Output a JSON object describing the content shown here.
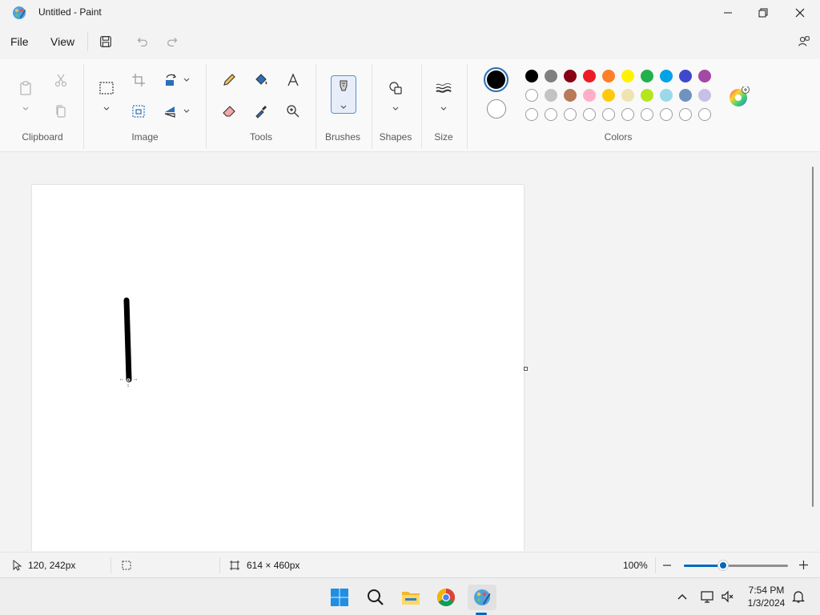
{
  "window": {
    "title": "Untitled - Paint"
  },
  "menu": {
    "file": "File",
    "view": "View"
  },
  "ribbon": {
    "groups": {
      "clipboard": "Clipboard",
      "image": "Image",
      "tools": "Tools",
      "brushes": "Brushes",
      "shapes": "Shapes",
      "size": "Size",
      "colors": "Colors"
    },
    "primary_color": "#000000",
    "secondary_color": "#ffffff",
    "palette_row1": [
      "#000000",
      "#7f7f7f",
      "#880015",
      "#ed1c24",
      "#ff7f27",
      "#fff200",
      "#22b14c",
      "#00a2e8",
      "#3f48cc",
      "#a349a4"
    ],
    "palette_row2": [
      "#ffffff",
      "#c3c3c3",
      "#b97a57",
      "#ffaec9",
      "#ffc90e",
      "#efe4b0",
      "#b5e61d",
      "#99d9ea",
      "#7092be",
      "#c8bfe7"
    ],
    "palette_row3_empty_count": 10
  },
  "status": {
    "cursor_position": "120, 242px",
    "canvas_size": "614 × 460px",
    "zoom": "100%",
    "zoom_slider_value": 0.38
  },
  "taskbar": {
    "time": "7:54 PM",
    "date": "1/3/2024"
  }
}
